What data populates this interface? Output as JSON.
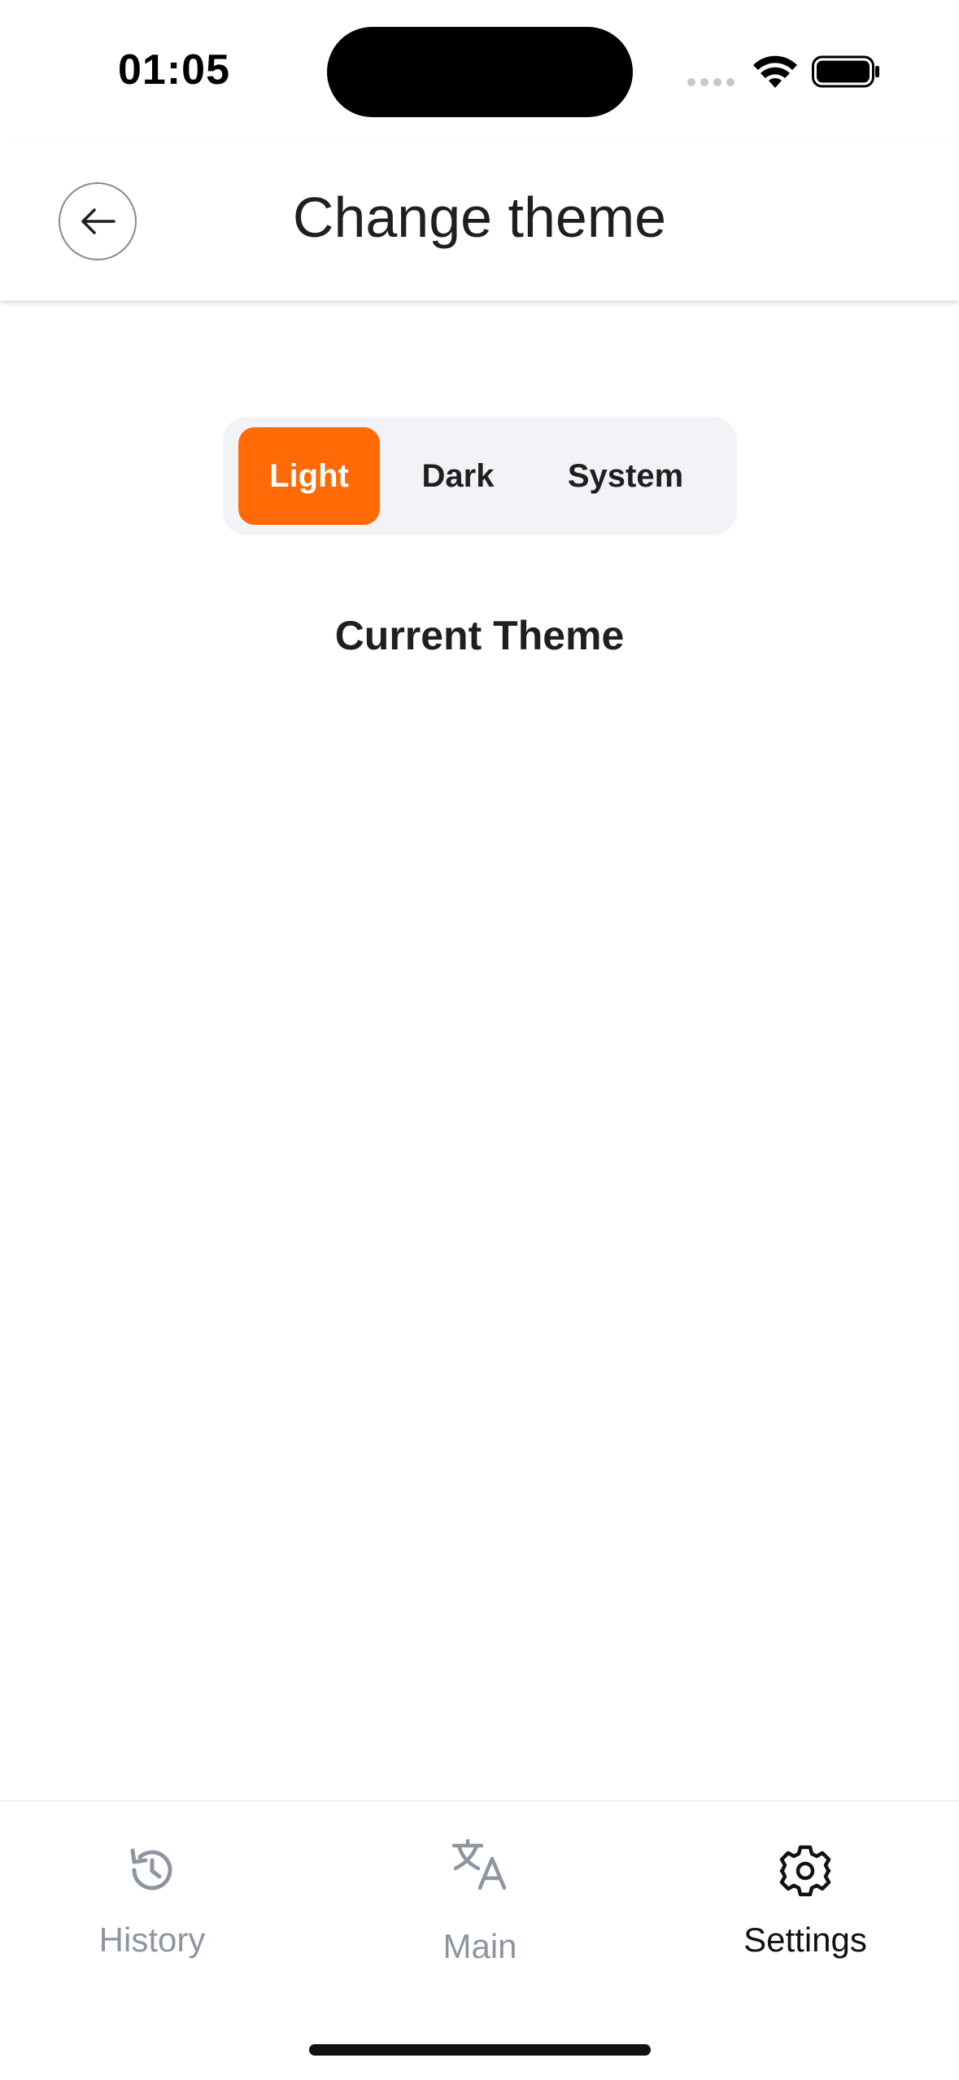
{
  "status_bar": {
    "time": "01:05"
  },
  "header": {
    "title": "Change theme",
    "back_icon": "arrow-left-icon"
  },
  "theme_selector": {
    "options": [
      "Light",
      "Dark",
      "System"
    ],
    "selected": "Light",
    "accent_color": "#ff6a06"
  },
  "current_theme_label": "Current Theme",
  "tab_bar": {
    "items": [
      {
        "label": "History",
        "icon": "history-icon",
        "active": false
      },
      {
        "label": "Main",
        "icon": "translate-icon",
        "active": false
      },
      {
        "label": "Settings",
        "icon": "gear-icon",
        "active": true
      }
    ]
  }
}
